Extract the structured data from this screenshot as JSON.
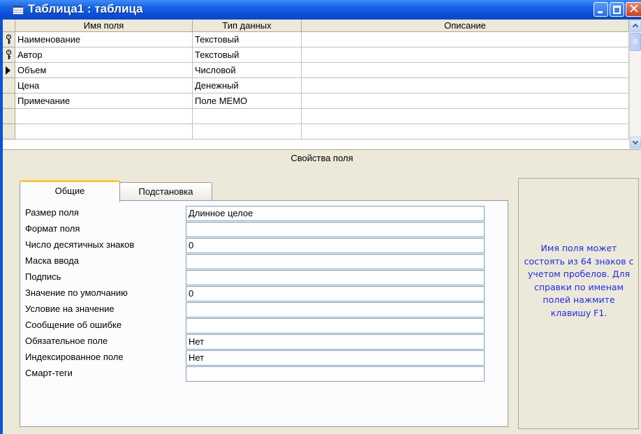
{
  "window": {
    "title": "Таблица1 : таблица",
    "icon": "table-icon",
    "buttons": [
      "minimize-icon",
      "maximize-icon",
      "close-icon"
    ],
    "close_glyph": "✕",
    "title_color": "#ffffff",
    "frame_color": "#0a52d8"
  },
  "grid": {
    "columns": [
      "Имя поля",
      "Тип данных",
      "Описание"
    ],
    "rows": [
      {
        "selector": "key-icon",
        "name": "Наименование",
        "type": "Текстовый",
        "description": ""
      },
      {
        "selector": "key-icon",
        "name": "Автор",
        "type": "Текстовый",
        "description": ""
      },
      {
        "selector": "current-row-arrow-icon",
        "name": "Объем",
        "type": "Числовой",
        "description": ""
      },
      {
        "selector": "",
        "name": "Цена",
        "type": "Денежный",
        "description": ""
      },
      {
        "selector": "",
        "name": "Примечание",
        "type": "Поле MEMO",
        "description": ""
      },
      {
        "selector": "",
        "name": "",
        "type": "",
        "description": ""
      },
      {
        "selector": "",
        "name": "",
        "type": "",
        "description": ""
      }
    ]
  },
  "properties": {
    "header": "Свойства поля",
    "tabs": [
      {
        "label": "Общие",
        "active": true
      },
      {
        "label": "Подстановка",
        "active": false
      }
    ],
    "general": [
      {
        "label": "Размер поля",
        "value": "Длинное целое"
      },
      {
        "label": "Формат поля",
        "value": ""
      },
      {
        "label": "Число десятичных знаков",
        "value": "0"
      },
      {
        "label": "Маска ввода",
        "value": ""
      },
      {
        "label": "Подпись",
        "value": ""
      },
      {
        "label": "Значение по умолчанию",
        "value": "0"
      },
      {
        "label": "Условие на значение",
        "value": ""
      },
      {
        "label": "Сообщение об ошибке",
        "value": ""
      },
      {
        "label": "Обязательное поле",
        "value": "Нет"
      },
      {
        "label": "Индексированное поле",
        "value": "Нет"
      },
      {
        "label": "Смарт-теги",
        "value": ""
      }
    ]
  },
  "hint": {
    "text": "Имя поля может состоять из 64 знаков с учетом пробелов.  Для справки по именам полей нажмите клавишу F1.",
    "color": "#1c2bf0"
  }
}
